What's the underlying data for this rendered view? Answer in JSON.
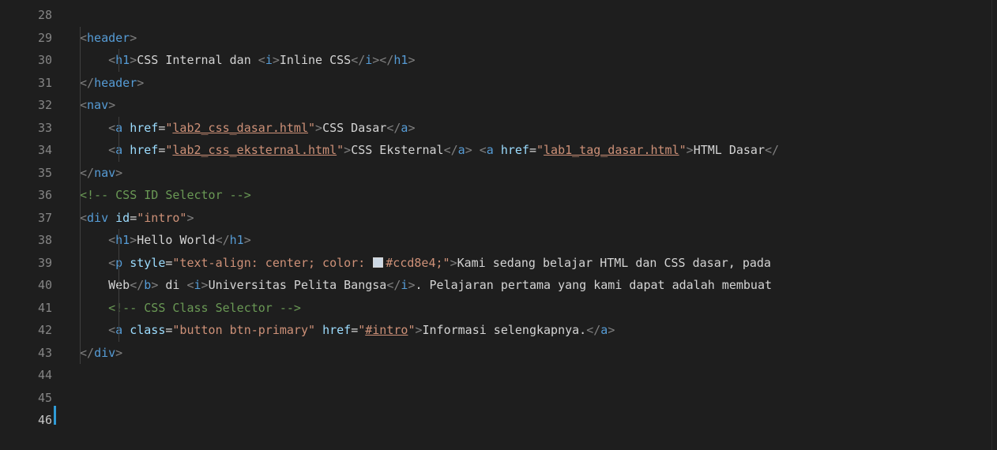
{
  "editor": {
    "lines": [
      {
        "n": "28"
      },
      {
        "n": "29",
        "segs": [
          [
            "punc",
            "<"
          ],
          [
            "tag",
            "header"
          ],
          [
            "punc",
            ">"
          ]
        ]
      },
      {
        "n": "30",
        "segs": [
          [
            "txt",
            "    "
          ],
          [
            "punc",
            "<"
          ],
          [
            "tag",
            "h1"
          ],
          [
            "punc",
            ">"
          ],
          [
            "txt",
            "CSS Internal dan "
          ],
          [
            "punc",
            "<"
          ],
          [
            "tag",
            "i"
          ],
          [
            "punc",
            ">"
          ],
          [
            "txt",
            "Inline CSS"
          ],
          [
            "punc",
            "</"
          ],
          [
            "tag",
            "i"
          ],
          [
            "punc",
            "></"
          ],
          [
            "tag",
            "h1"
          ],
          [
            "punc",
            ">"
          ]
        ]
      },
      {
        "n": "31",
        "segs": [
          [
            "punc",
            "</"
          ],
          [
            "tag",
            "header"
          ],
          [
            "punc",
            ">"
          ]
        ]
      },
      {
        "n": "32",
        "segs": [
          [
            "punc",
            "<"
          ],
          [
            "tag",
            "nav"
          ],
          [
            "punc",
            ">"
          ]
        ]
      },
      {
        "n": "33",
        "segs": [
          [
            "txt",
            "    "
          ],
          [
            "punc",
            "<"
          ],
          [
            "tag",
            "a"
          ],
          [
            "txt",
            " "
          ],
          [
            "attr",
            "href"
          ],
          [
            "txt",
            "="
          ],
          [
            "str",
            "\""
          ],
          [
            "strlink",
            "lab2_css_dasar.html"
          ],
          [
            "str",
            "\""
          ],
          [
            "punc",
            ">"
          ],
          [
            "txt",
            "CSS Dasar"
          ],
          [
            "punc",
            "</"
          ],
          [
            "tag",
            "a"
          ],
          [
            "punc",
            ">"
          ]
        ]
      },
      {
        "n": "34",
        "segs": [
          [
            "txt",
            "    "
          ],
          [
            "punc",
            "<"
          ],
          [
            "tag",
            "a"
          ],
          [
            "txt",
            " "
          ],
          [
            "attr",
            "href"
          ],
          [
            "txt",
            "="
          ],
          [
            "str",
            "\""
          ],
          [
            "strlink",
            "lab2_css_eksternal.html"
          ],
          [
            "str",
            "\""
          ],
          [
            "punc",
            ">"
          ],
          [
            "txt",
            "CSS Eksternal"
          ],
          [
            "punc",
            "</"
          ],
          [
            "tag",
            "a"
          ],
          [
            "punc",
            ">"
          ],
          [
            "txt",
            " "
          ],
          [
            "punc",
            "<"
          ],
          [
            "tag",
            "a"
          ],
          [
            "txt",
            " "
          ],
          [
            "attr",
            "href"
          ],
          [
            "txt",
            "="
          ],
          [
            "str",
            "\""
          ],
          [
            "strlink",
            "lab1_tag_dasar.html"
          ],
          [
            "str",
            "\""
          ],
          [
            "punc",
            ">"
          ],
          [
            "txt",
            "HTML Dasar"
          ],
          [
            "punc",
            "</"
          ]
        ]
      },
      {
        "n": "35",
        "segs": [
          [
            "punc",
            "</"
          ],
          [
            "tag",
            "nav"
          ],
          [
            "punc",
            ">"
          ]
        ]
      },
      {
        "n": "36",
        "segs": [
          [
            "cmt",
            "<!-- CSS ID Selector -->"
          ]
        ]
      },
      {
        "n": "37",
        "segs": [
          [
            "punc",
            "<"
          ],
          [
            "tag",
            "div"
          ],
          [
            "txt",
            " "
          ],
          [
            "attr",
            "id"
          ],
          [
            "txt",
            "="
          ],
          [
            "str",
            "\"intro\""
          ],
          [
            "punc",
            ">"
          ]
        ]
      },
      {
        "n": "38",
        "segs": [
          [
            "txt",
            "    "
          ],
          [
            "punc",
            "<"
          ],
          [
            "tag",
            "h1"
          ],
          [
            "punc",
            ">"
          ],
          [
            "txt",
            "Hello World"
          ],
          [
            "punc",
            "</"
          ],
          [
            "tag",
            "h1"
          ],
          [
            "punc",
            ">"
          ]
        ]
      },
      {
        "n": "39",
        "segs": [
          [
            "txt",
            "    "
          ],
          [
            "punc",
            "<"
          ],
          [
            "tag",
            "p"
          ],
          [
            "txt",
            " "
          ],
          [
            "attr",
            "style"
          ],
          [
            "txt",
            "="
          ],
          [
            "str",
            "\"text-align: center; color: "
          ],
          [
            "swatch",
            "#ccd8e4"
          ],
          [
            "str",
            "#ccd8e4;\""
          ],
          [
            "punc",
            ">"
          ],
          [
            "txt",
            "Kami sedang belajar HTML dan CSS dasar, pada"
          ]
        ]
      },
      {
        "n": "40",
        "segs": [
          [
            "txt",
            "    Web"
          ],
          [
            "punc",
            "</"
          ],
          [
            "tag",
            "b"
          ],
          [
            "punc",
            ">"
          ],
          [
            "txt",
            " di "
          ],
          [
            "punc",
            "<"
          ],
          [
            "tag",
            "i"
          ],
          [
            "punc",
            ">"
          ],
          [
            "txt",
            "Universitas Pelita Bangsa"
          ],
          [
            "punc",
            "</"
          ],
          [
            "tag",
            "i"
          ],
          [
            "punc",
            ">"
          ],
          [
            "txt",
            ". Pelajaran pertama yang kami dapat adalah membuat"
          ]
        ]
      },
      {
        "n": "41",
        "segs": [
          [
            "txt",
            "    "
          ],
          [
            "cmt",
            "<!-- CSS Class Selector -->"
          ]
        ]
      },
      {
        "n": "42",
        "segs": [
          [
            "txt",
            "    "
          ],
          [
            "punc",
            "<"
          ],
          [
            "tag",
            "a"
          ],
          [
            "txt",
            " "
          ],
          [
            "attr",
            "class"
          ],
          [
            "txt",
            "="
          ],
          [
            "str",
            "\"button btn-primary\""
          ],
          [
            "txt",
            " "
          ],
          [
            "attr",
            "href"
          ],
          [
            "txt",
            "="
          ],
          [
            "str",
            "\""
          ],
          [
            "strlink",
            "#intro"
          ],
          [
            "str",
            "\""
          ],
          [
            "punc",
            ">"
          ],
          [
            "txt",
            "Informasi selengkapnya."
          ],
          [
            "punc",
            "</"
          ],
          [
            "tag",
            "a"
          ],
          [
            "punc",
            ">"
          ]
        ]
      },
      {
        "n": "43",
        "segs": [
          [
            "punc",
            "</"
          ],
          [
            "tag",
            "div"
          ],
          [
            "punc",
            ">"
          ]
        ]
      },
      {
        "n": "44"
      },
      {
        "n": "45"
      },
      {
        "n": "46"
      }
    ],
    "active_line": "46"
  }
}
